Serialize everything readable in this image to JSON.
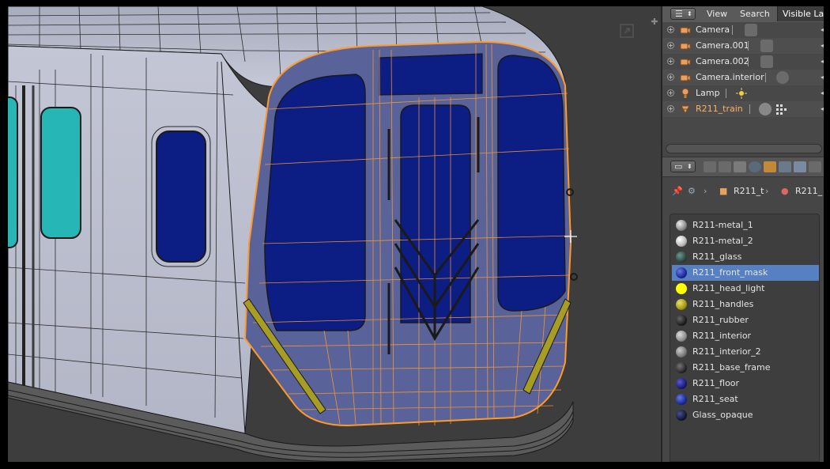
{
  "outliner": {
    "menu": {
      "view": "View",
      "search": "Search",
      "display_mode": "Visible Layers"
    },
    "objects": [
      {
        "name": "Camera",
        "type": "camera"
      },
      {
        "name": "Camera.001",
        "type": "camera"
      },
      {
        "name": "Camera.002",
        "type": "camera"
      },
      {
        "name": "Camera.interior",
        "type": "camera"
      },
      {
        "name": "Lamp",
        "type": "lamp"
      },
      {
        "name": "R211_train",
        "type": "mesh",
        "selected": true
      }
    ]
  },
  "properties": {
    "context": "material",
    "breadcrumb": {
      "object": "R211_t",
      "material": "R211_"
    },
    "materials": [
      {
        "name": "R211-metal_1",
        "color": "#9a9a9a"
      },
      {
        "name": "R211-metal_2",
        "color": "#b8b8b8"
      },
      {
        "name": "R211_glass",
        "color": "#2f4a44"
      },
      {
        "name": "R211_front_mask",
        "color": "#1a2c9a",
        "selected": true
      },
      {
        "name": "R211_head_light",
        "color": "#ffff00"
      },
      {
        "name": "R211_handles",
        "color": "#a59a10"
      },
      {
        "name": "R211_rubber",
        "color": "#1f1f1f"
      },
      {
        "name": "R211_interior",
        "color": "#8f8f8f"
      },
      {
        "name": "R211_interior_2",
        "color": "#7a7a7a"
      },
      {
        "name": "R211_base_frame",
        "color": "#2a2a2a"
      },
      {
        "name": "R211_floor",
        "color": "#1b1b7a"
      },
      {
        "name": "R211_seat",
        "color": "#1a2a9a"
      },
      {
        "name": "Glass_opaque",
        "color": "#14183a"
      }
    ]
  },
  "viewport": {
    "body_color": "#b9bccb",
    "front_mask_color": "#505a96",
    "glass_color": "#0c1d84",
    "side_glass_color": "#27b6b6",
    "edge_select_color": "#ff9a2a",
    "headlight_color": "#a79d25"
  }
}
